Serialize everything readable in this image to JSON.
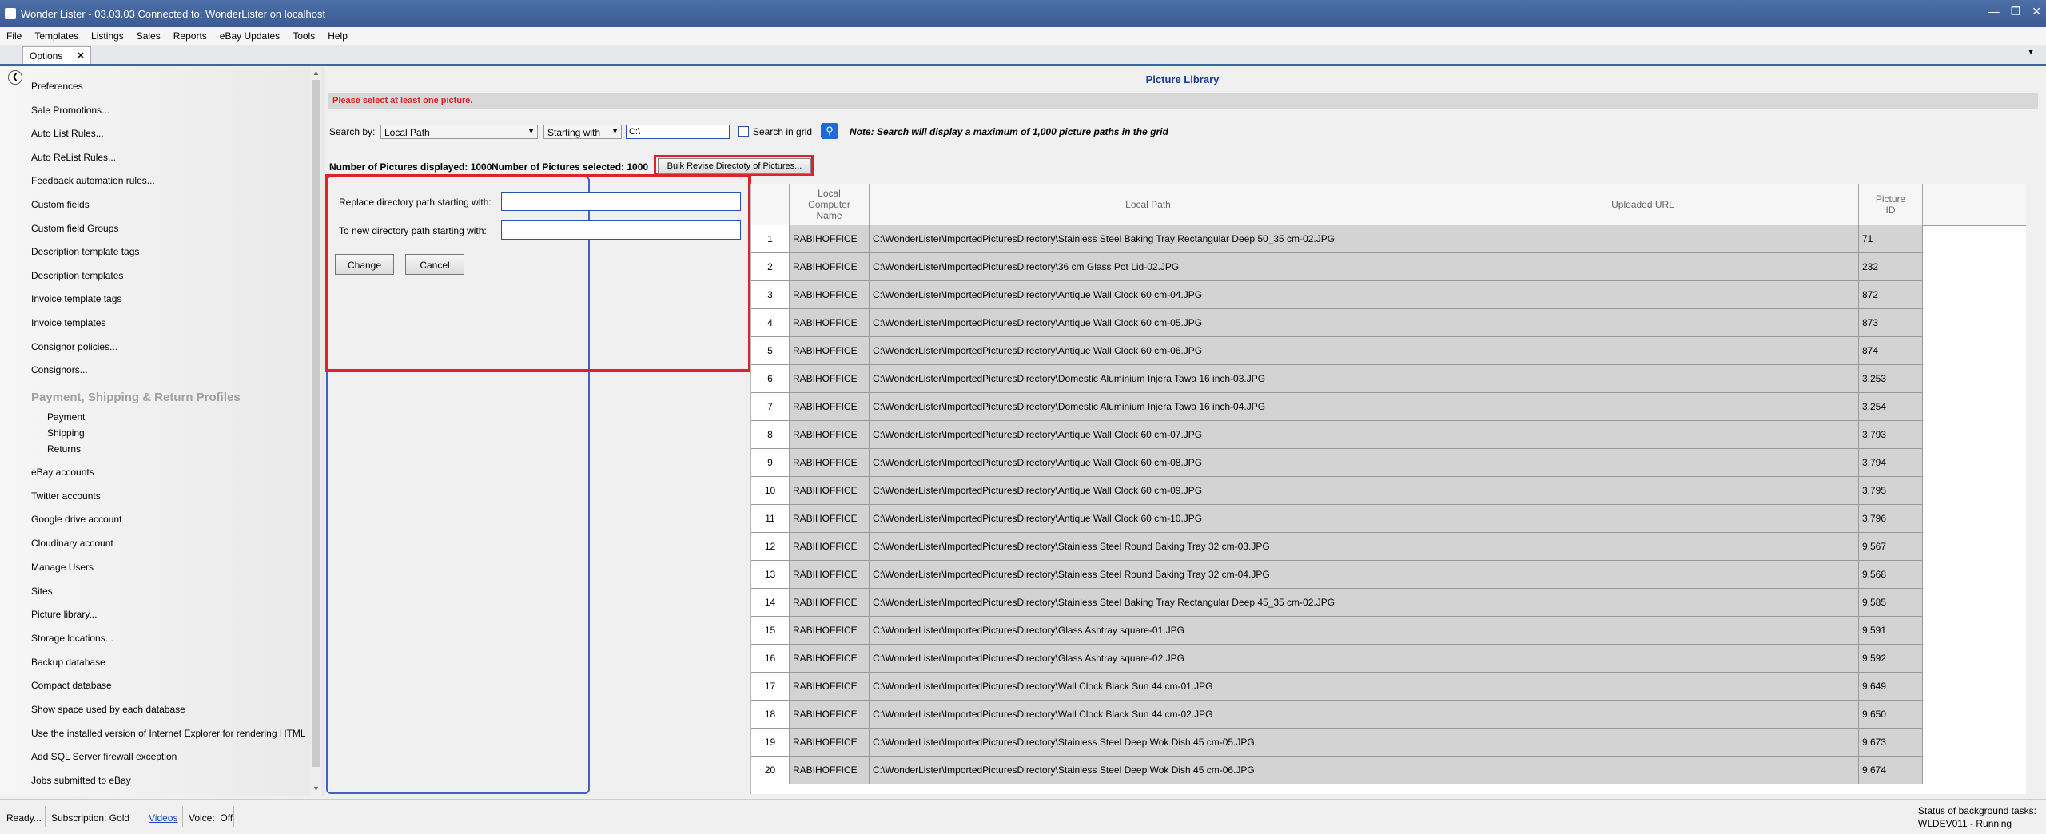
{
  "window": {
    "title": "Wonder Lister - 03.03.03 Connected to: WonderLister on localhost"
  },
  "menu": [
    "File",
    "Templates",
    "Listings",
    "Sales",
    "Reports",
    "eBay Updates",
    "Tools",
    "Help"
  ],
  "tab": {
    "label": "Options",
    "close": "✕"
  },
  "sidebar": {
    "items_top": [
      "Preferences",
      "Sale Promotions...",
      "Auto List Rules...",
      "Auto ReList Rules...",
      "Feedback automation rules...",
      "Custom fields",
      "Custom field Groups",
      "Description template tags",
      "Description templates",
      "Invoice template tags",
      "Invoice templates",
      "Consignor policies...",
      "Consignors..."
    ],
    "group_title": "Payment, Shipping & Return Profiles",
    "group_items": [
      "Payment",
      "Shipping",
      "Returns"
    ],
    "items_bottom": [
      "eBay accounts",
      "Twitter accounts",
      "Google drive account",
      "Cloudinary account",
      "Manage Users",
      "Sites",
      "Picture library...",
      "Storage locations...",
      "Backup database",
      "Compact database",
      "Show space used by each database",
      "Use the installed version of Internet Explorer for rendering HTML",
      "Add SQL Server firewall exception",
      "Jobs submitted to eBay"
    ]
  },
  "panel": {
    "title": "Picture Library",
    "message": "Please select at least one picture.",
    "search": {
      "label": "Search by:",
      "field": "Local Path",
      "mode": "Starting with",
      "value": "C:\\",
      "grid_label": "Search in grid",
      "note": "Note: Search will display a maximum of 1,000 picture paths in the grid"
    },
    "counts": {
      "displayed": "Number of Pictures displayed: 1000",
      "selected": "Number of Pictures selected: 1000"
    },
    "bulk_button": "Bulk Revise Directoty of Pictures...",
    "form": {
      "replace_label": "Replace directory path starting with:",
      "new_label": "To new directory path starting with:",
      "change": "Change",
      "cancel": "Cancel"
    }
  },
  "grid": {
    "columns": [
      "",
      "Local Computer Name",
      "Local Path",
      "Uploaded URL",
      "Picture ID"
    ],
    "rows": [
      [
        "1",
        "RABIHOFFICE",
        "C:\\WonderLister\\ImportedPicturesDirectory\\Stainless Steel Baking Tray Rectangular Deep 50_35 cm-02.JPG",
        "",
        "71"
      ],
      [
        "2",
        "RABIHOFFICE",
        "C:\\WonderLister\\ImportedPicturesDirectory\\36 cm Glass Pot Lid-02.JPG",
        "",
        "232"
      ],
      [
        "3",
        "RABIHOFFICE",
        "C:\\WonderLister\\ImportedPicturesDirectory\\Antique Wall Clock 60 cm-04.JPG",
        "",
        "872"
      ],
      [
        "4",
        "RABIHOFFICE",
        "C:\\WonderLister\\ImportedPicturesDirectory\\Antique Wall Clock 60 cm-05.JPG",
        "",
        "873"
      ],
      [
        "5",
        "RABIHOFFICE",
        "C:\\WonderLister\\ImportedPicturesDirectory\\Antique Wall Clock 60 cm-06.JPG",
        "",
        "874"
      ],
      [
        "6",
        "RABIHOFFICE",
        "C:\\WonderLister\\ImportedPicturesDirectory\\Domestic Aluminium Injera Tawa 16 inch-03.JPG",
        "",
        "3,253"
      ],
      [
        "7",
        "RABIHOFFICE",
        "C:\\WonderLister\\ImportedPicturesDirectory\\Domestic Aluminium Injera Tawa 16 inch-04.JPG",
        "",
        "3,254"
      ],
      [
        "8",
        "RABIHOFFICE",
        "C:\\WonderLister\\ImportedPicturesDirectory\\Antique Wall Clock 60 cm-07.JPG",
        "",
        "3,793"
      ],
      [
        "9",
        "RABIHOFFICE",
        "C:\\WonderLister\\ImportedPicturesDirectory\\Antique Wall Clock 60 cm-08.JPG",
        "",
        "3,794"
      ],
      [
        "10",
        "RABIHOFFICE",
        "C:\\WonderLister\\ImportedPicturesDirectory\\Antique Wall Clock 60 cm-09.JPG",
        "",
        "3,795"
      ],
      [
        "11",
        "RABIHOFFICE",
        "C:\\WonderLister\\ImportedPicturesDirectory\\Antique Wall Clock 60 cm-10.JPG",
        "",
        "3,796"
      ],
      [
        "12",
        "RABIHOFFICE",
        "C:\\WonderLister\\ImportedPicturesDirectory\\Stainless Steel Round Baking Tray 32 cm-03.JPG",
        "",
        "9,567"
      ],
      [
        "13",
        "RABIHOFFICE",
        "C:\\WonderLister\\ImportedPicturesDirectory\\Stainless Steel Round Baking Tray 32 cm-04.JPG",
        "",
        "9,568"
      ],
      [
        "14",
        "RABIHOFFICE",
        "C:\\WonderLister\\ImportedPicturesDirectory\\Stainless Steel Baking Tray Rectangular Deep 45_35 cm-02.JPG",
        "",
        "9,585"
      ],
      [
        "15",
        "RABIHOFFICE",
        "C:\\WonderLister\\ImportedPicturesDirectory\\Glass Ashtray square-01.JPG",
        "",
        "9,591"
      ],
      [
        "16",
        "RABIHOFFICE",
        "C:\\WonderLister\\ImportedPicturesDirectory\\Glass Ashtray square-02.JPG",
        "",
        "9,592"
      ],
      [
        "17",
        "RABIHOFFICE",
        "C:\\WonderLister\\ImportedPicturesDirectory\\Wall Clock Black Sun 44 cm-01.JPG",
        "",
        "9,649"
      ],
      [
        "18",
        "RABIHOFFICE",
        "C:\\WonderLister\\ImportedPicturesDirectory\\Wall Clock Black Sun 44 cm-02.JPG",
        "",
        "9,650"
      ],
      [
        "19",
        "RABIHOFFICE",
        "C:\\WonderLister\\ImportedPicturesDirectory\\Stainless Steel Deep Wok Dish 45 cm-05.JPG",
        "",
        "9,673"
      ],
      [
        "20",
        "RABIHOFFICE",
        "C:\\WonderLister\\ImportedPicturesDirectory\\Stainless Steel Deep Wok Dish 45 cm-06.JPG",
        "",
        "9,674"
      ]
    ]
  },
  "status": {
    "ready": "Ready...",
    "subscription": "Subscription: Gold",
    "videos": "Videos",
    "voice": "Voice:  Off",
    "bg_title": "Status of background tasks:",
    "bg_value": "WLDEV011 - Running"
  }
}
